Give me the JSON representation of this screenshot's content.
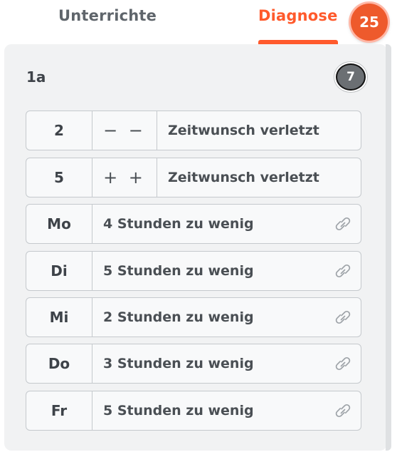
{
  "tabs": {
    "unterrichte": "Unterrichte",
    "diagnose": "Diagnose",
    "diagnose_count": "25"
  },
  "panel": {
    "class_name": "1a",
    "count": "7"
  },
  "time_rows": [
    {
      "key": "2",
      "symbol": "− −",
      "text": "Zeitwunsch verletzt"
    },
    {
      "key": "5",
      "symbol": "+ +",
      "text": "Zeitwunsch verletzt"
    }
  ],
  "day_rows": [
    {
      "key": "Mo",
      "text": "4 Stunden zu wenig",
      "icon": "link-icon"
    },
    {
      "key": "Di",
      "text": "5 Stunden zu wenig",
      "icon": "link-icon"
    },
    {
      "key": "Mi",
      "text": "2 Stunden zu wenig",
      "icon": "link-icon"
    },
    {
      "key": "Do",
      "text": "3 Stunden zu wenig",
      "icon": "link-icon"
    },
    {
      "key": "Fr",
      "text": "5 Stunden zu wenig",
      "icon": "link-icon"
    }
  ],
  "colors": {
    "accent": "#ff5a2c",
    "panel_bg": "#f1f2f3",
    "badge_gray": "#6b6f73"
  }
}
